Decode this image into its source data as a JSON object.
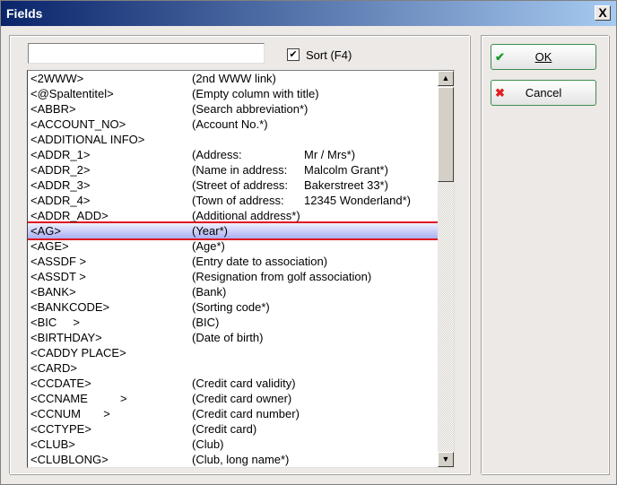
{
  "window": {
    "title": "Fields",
    "close": "X"
  },
  "search": {
    "value": ""
  },
  "sort": {
    "label": "Sort (F4)",
    "checked": true
  },
  "buttons": {
    "ok": "OK",
    "cancel": "Cancel"
  },
  "rows": [
    {
      "name": "<2WWW>",
      "desc": "(2nd WWW link)",
      "extra": ""
    },
    {
      "name": "<@Spaltentitel>",
      "desc": "(Empty column with title)",
      "extra": ""
    },
    {
      "name": "<ABBR>",
      "desc": "(Search abbreviation*)",
      "extra": ""
    },
    {
      "name": "<ACCOUNT_NO>",
      "desc": "(Account No.*)",
      "extra": ""
    },
    {
      "name": "<ADDITIONAL INFO>",
      "desc": "",
      "extra": ""
    },
    {
      "name": "<ADDR_1>",
      "desc": "(Address:",
      "extra": "Mr / Mrs*)"
    },
    {
      "name": "<ADDR_2>",
      "desc": "(Name in address:",
      "extra": "Malcolm Grant*)"
    },
    {
      "name": "<ADDR_3>",
      "desc": "(Street of address:",
      "extra": "Bakerstreet 33*)"
    },
    {
      "name": "<ADDR_4>",
      "desc": "(Town of address:",
      "extra": "12345 Wonderland*)"
    },
    {
      "name": "<ADDR_ADD>",
      "desc": "(Additional address*)",
      "extra": ""
    },
    {
      "name": "<AG>",
      "desc": "(Year*)",
      "extra": "",
      "selected": true
    },
    {
      "name": "<AGE>",
      "desc": "(Age*)",
      "extra": ""
    },
    {
      "name": "<ASSDF >",
      "desc": "(Entry date to association)",
      "extra": ""
    },
    {
      "name": "<ASSDT >",
      "desc": "(Resignation from golf association)",
      "extra": ""
    },
    {
      "name": "<BANK>",
      "desc": "(Bank)",
      "extra": ""
    },
    {
      "name": "<BANKCODE>",
      "desc": "(Sorting code*)",
      "extra": ""
    },
    {
      "name": "<BIC     >",
      "desc": "(BIC)",
      "extra": ""
    },
    {
      "name": "<BIRTHDAY>",
      "desc": "(Date of birth)",
      "extra": ""
    },
    {
      "name": "<CADDY PLACE>",
      "desc": "",
      "extra": ""
    },
    {
      "name": "<CARD>",
      "desc": "",
      "extra": ""
    },
    {
      "name": "<CCDATE>",
      "desc": "(Credit card validity)",
      "extra": ""
    },
    {
      "name": "<CCNAME          >",
      "desc": "(Credit card owner)",
      "extra": ""
    },
    {
      "name": "<CCNUM       >",
      "desc": "(Credit card number)",
      "extra": ""
    },
    {
      "name": "<CCTYPE>",
      "desc": "(Credit card)",
      "extra": ""
    },
    {
      "name": "<CLUB>",
      "desc": "(Club)",
      "extra": ""
    },
    {
      "name": "<CLUBLONG>",
      "desc": "(Club, long name*)",
      "extra": ""
    }
  ]
}
